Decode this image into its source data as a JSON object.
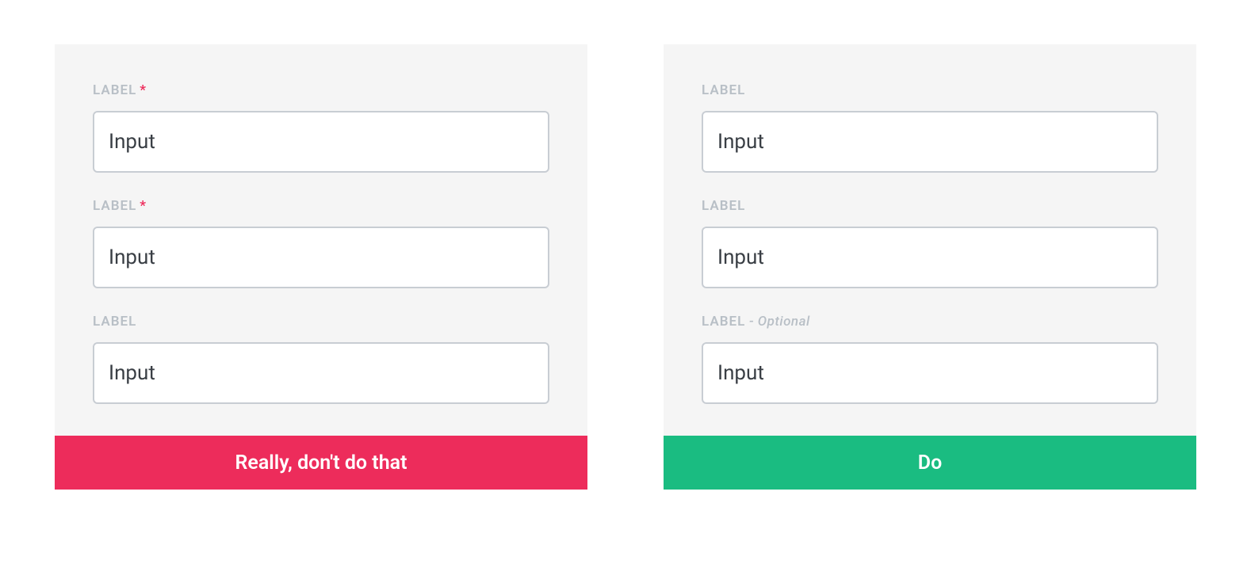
{
  "dont_panel": {
    "fields": [
      {
        "label": "LABEL",
        "required": true,
        "value": "Input"
      },
      {
        "label": "LABEL",
        "required": true,
        "value": "Input"
      },
      {
        "label": "LABEL",
        "required": false,
        "value": "Input"
      }
    ],
    "asterisk": "*",
    "banner": "Really, don't do that"
  },
  "do_panel": {
    "fields": [
      {
        "label": "LABEL",
        "value": "Input"
      },
      {
        "label": "LABEL",
        "value": "Input"
      },
      {
        "label": "LABEL",
        "optional_suffix": " - Optional",
        "value": "Input"
      }
    ],
    "banner": "Do"
  }
}
